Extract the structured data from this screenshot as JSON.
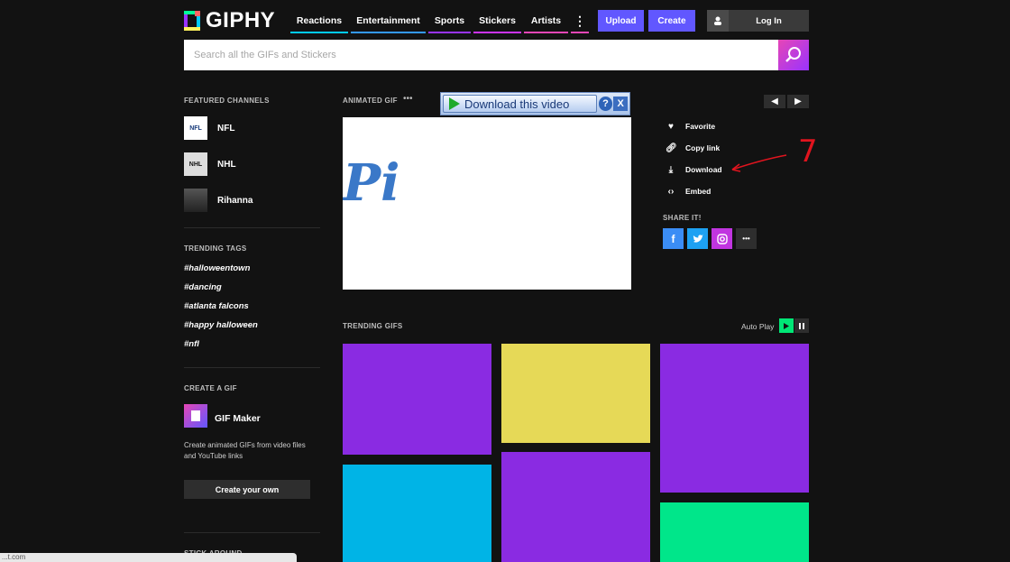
{
  "header": {
    "logo_text": "GIPHY",
    "nav": [
      {
        "label": "Reactions",
        "color": "#00ccff"
      },
      {
        "label": "Entertainment",
        "color": "#3399ff"
      },
      {
        "label": "Sports",
        "color": "#9933ff"
      },
      {
        "label": "Stickers",
        "color": "#cc33ff"
      },
      {
        "label": "Artists",
        "color": "#e646b6"
      }
    ],
    "more_icon": "vertical-ellipsis-icon",
    "upload_label": "Upload",
    "create_label": "Create",
    "login_label": "Log In",
    "search_placeholder": "Search all the GIFs and Stickers"
  },
  "sidebar": {
    "featured_title": "FEATURED CHANNELS",
    "channels": [
      {
        "name": "NFL",
        "thumb": "NFL"
      },
      {
        "name": "NHL",
        "thumb": "NHL"
      },
      {
        "name": "Rihanna",
        "thumb": ""
      }
    ],
    "trending_tags_title": "TRENDING TAGS",
    "tags": [
      "#halloweentown",
      "#dancing",
      "#atlanta falcons",
      "#happy halloween",
      "#nfl"
    ],
    "create_title": "CREATE A GIF",
    "gif_maker_label": "GIF Maker",
    "gif_maker_desc": "Create animated GIFs from video files and YouTube links",
    "create_own_label": "Create your own",
    "stick_around_title": "STICK AROUND"
  },
  "main": {
    "animated_gif_title": "ANIMATED GIF",
    "animated_gif_more": "•••",
    "gif_text": "Pi",
    "download_bar_label": "Download this video",
    "download_help": "?",
    "download_close": "X",
    "actions": [
      {
        "label": "Favorite",
        "icon": "heart-icon"
      },
      {
        "label": "Copy link",
        "icon": "link-icon"
      },
      {
        "label": "Download",
        "icon": "download-icon"
      },
      {
        "label": "Embed",
        "icon": "code-icon"
      }
    ],
    "share_title": "SHARE IT!",
    "share_buttons": [
      {
        "name": "facebook",
        "glyph": "f",
        "color": "#3b8df5"
      },
      {
        "name": "twitter",
        "glyph": "t",
        "color": "#1da1f2"
      },
      {
        "name": "instagram",
        "glyph": "◎",
        "color": "#c135e0"
      },
      {
        "name": "more",
        "glyph": "•••",
        "color": "#2e2e2e"
      }
    ],
    "annotation_number": "7",
    "trending_title": "TRENDING GIFS",
    "autoplay_label": "Auto Play",
    "tile_colors": [
      "#8a2be2",
      "#e6d957",
      "#8a2be2",
      "#00b4e6",
      "#8a2be2",
      "#00e68a"
    ]
  },
  "status_bar_text": "...t.com"
}
